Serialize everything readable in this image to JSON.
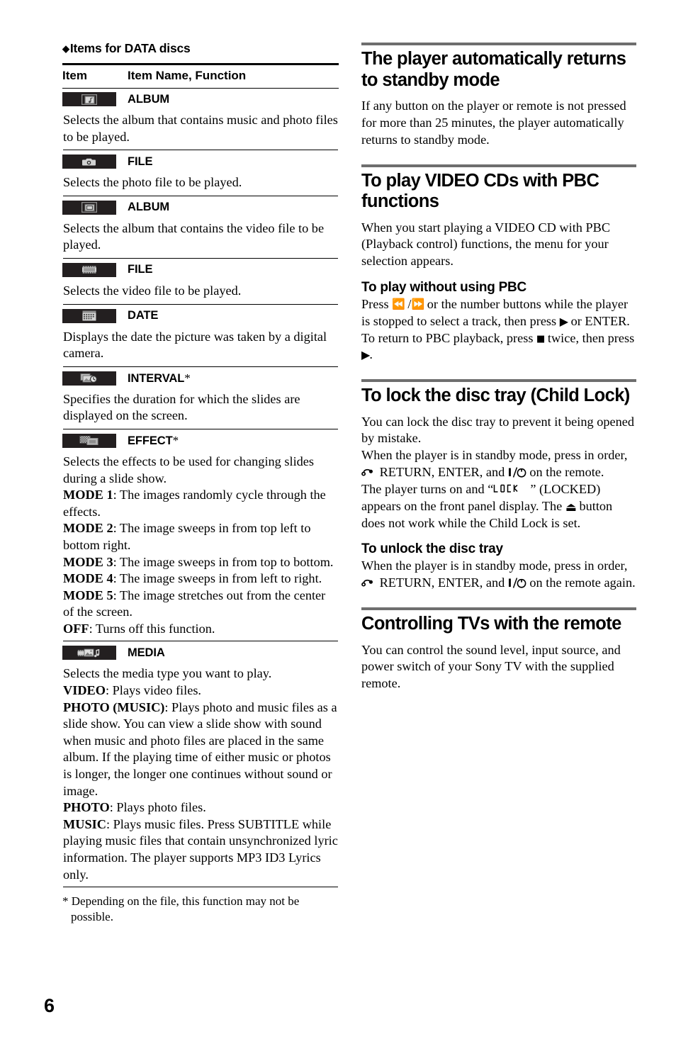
{
  "page": {
    "number": "6"
  },
  "left": {
    "section_title": "Items for DATA discs",
    "table": {
      "headers": [
        "Item",
        "Item Name, Function"
      ],
      "rows": [
        {
          "icon": "album-music-photo-icon",
          "name": "ALBUM",
          "desc": "Selects the album that contains music and photo files to be played."
        },
        {
          "icon": "photo-file-camera-icon",
          "name": "FILE",
          "desc": "Selects the photo file to be played."
        },
        {
          "icon": "album-video-icon",
          "name": "ALBUM",
          "desc": "Selects the album that contains the video file to be played."
        },
        {
          "icon": "video-file-filmstrip-icon",
          "name": "FILE",
          "desc": "Selects the video file to be played."
        },
        {
          "icon": "date-calendar-icon",
          "name": "DATE",
          "desc": "Displays the date the picture was taken by a digital camera."
        },
        {
          "icon": "interval-clock-icon",
          "name": "INTERVAL",
          "asterisk": "*",
          "desc": "Specifies the duration for which the slides are displayed on the screen."
        },
        {
          "icon": "effect-transition-icon",
          "name": "EFFECT",
          "asterisk": "*",
          "desc": "Selects the effects to be used for changing slides during a slide show.",
          "modes": [
            {
              "label": "MODE 1",
              "text": ": The images randomly cycle through the effects."
            },
            {
              "label": "MODE 2",
              "text": ": The image sweeps in from top left to bottom right."
            },
            {
              "label": "MODE 3",
              "text": ": The image sweeps in from top to bottom."
            },
            {
              "label": "MODE 4",
              "text": ": The image sweeps in from left to right."
            },
            {
              "label": "MODE 5",
              "text": ": The image stretches out from the center of the screen."
            },
            {
              "label": "OFF",
              "text": ": Turns off this function."
            }
          ]
        },
        {
          "icon": "media-type-icon",
          "name": "MEDIA",
          "desc": "Selects the media type you want to play.",
          "modes": [
            {
              "label": "VIDEO",
              "text": ": Plays video files."
            },
            {
              "label": "PHOTO (MUSIC)",
              "text": ": Plays photo and music files as a slide show. You can view a slide show with sound when music and photo files are placed in the same album. If the playing time of either music or photos is longer, the longer one continues without sound or image."
            },
            {
              "label": "PHOTO",
              "text": ": Plays photo files."
            },
            {
              "label": "MUSIC",
              "text": ": Plays music files. Press SUBTITLE while playing music files that contain unsynchronized lyric information. The player supports MP3 ID3 Lyrics only."
            }
          ]
        }
      ]
    },
    "footnote": "* Depending on the file, this function may not be possible."
  },
  "right": {
    "standby": {
      "heading": "The player automatically returns to standby mode",
      "body": "If any button on the player or remote is not pressed for more than 25 minutes, the player automatically returns to standby mode."
    },
    "pbc": {
      "heading": "To play VIDEO CDs with PBC functions",
      "body": "When you start playing a VIDEO CD with PBC (Playback control) functions, the menu for your selection appears.",
      "sub_heading": "To play without using PBC",
      "line1_a": "Press ",
      "line1_b": " or the number buttons while the player is stopped to select a track, then press ",
      "line1_c": " or ENTER. To return to PBC playback, press ",
      "line1_d": " twice, then press ",
      "line1_e": "."
    },
    "childlock": {
      "heading": "To lock the disc tray (Child Lock)",
      "body1": "You can lock the disc tray to prevent it being opened by mistake.",
      "body2_a": "When the player is in standby mode, press in order, ",
      "body2_b": " RETURN, ENTER, and ",
      "body2_c": " on the remote.",
      "body3_a": "The player turns on and “",
      "body3_lcd": "LOCK",
      "body3_b": "” (LOCKED) appears on the front panel display. The ",
      "body3_c": " button does not work while the Child Lock is set.",
      "sub_heading": "To unlock the disc tray",
      "unlock_a": "When the player is in standby mode, press in order, ",
      "unlock_b": " RETURN, ENTER, and ",
      "unlock_c": " on the remote again."
    },
    "tvremote": {
      "heading": "Controlling TVs with the remote",
      "body": "You can control the sound level, input source, and power switch of your Sony TV with the supplied remote."
    }
  }
}
